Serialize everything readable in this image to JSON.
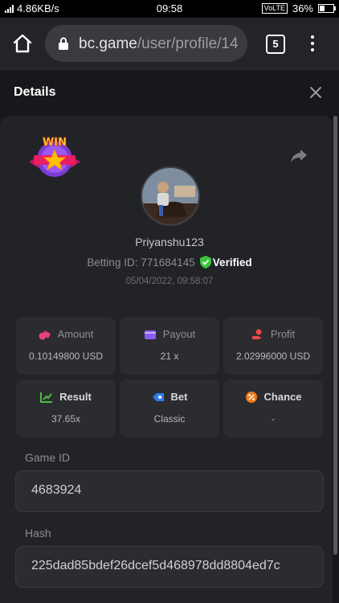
{
  "status_bar": {
    "net_speed": "4.86KB/s",
    "time": "09:58",
    "volte": "VoLTE",
    "battery": "36%",
    "battery_level": 0.36
  },
  "browser": {
    "url_domain": "bc.game",
    "url_path": "/user/profile/14",
    "tab_count": "5"
  },
  "details": {
    "title": "Details",
    "badge_text": "WIN",
    "username": "Priyanshu123",
    "betting_id_label": "Betting ID:",
    "betting_id": "771684145",
    "verified_label": "Verified",
    "timestamp": "05/04/2022, 09:58:07",
    "stats": [
      {
        "label": "Amount",
        "value": "0.10149800 USD",
        "icon": "coins-icon",
        "color": "#e8427a"
      },
      {
        "label": "Payout",
        "value": "21 x",
        "icon": "wallet-icon",
        "color": "#8a5cf6"
      },
      {
        "label": "Profit",
        "value": "2.02996000 USD",
        "icon": "profit-hand-icon",
        "color": "#e64a4a"
      },
      {
        "label": "Result",
        "value": "37.65x",
        "icon": "result-icon",
        "color": "#4cbe3f"
      },
      {
        "label": "Bet",
        "value": "Classic",
        "icon": "bet-tag-icon",
        "color": "#2f7cf6"
      },
      {
        "label": "Chance",
        "value": "-",
        "icon": "chance-icon",
        "color": "#f07a1c"
      }
    ],
    "game_id_label": "Game ID",
    "game_id": "4683924",
    "hash_label": "Hash",
    "hash": "225dad85bdef26dcef5d468978dd8804ed7c"
  }
}
